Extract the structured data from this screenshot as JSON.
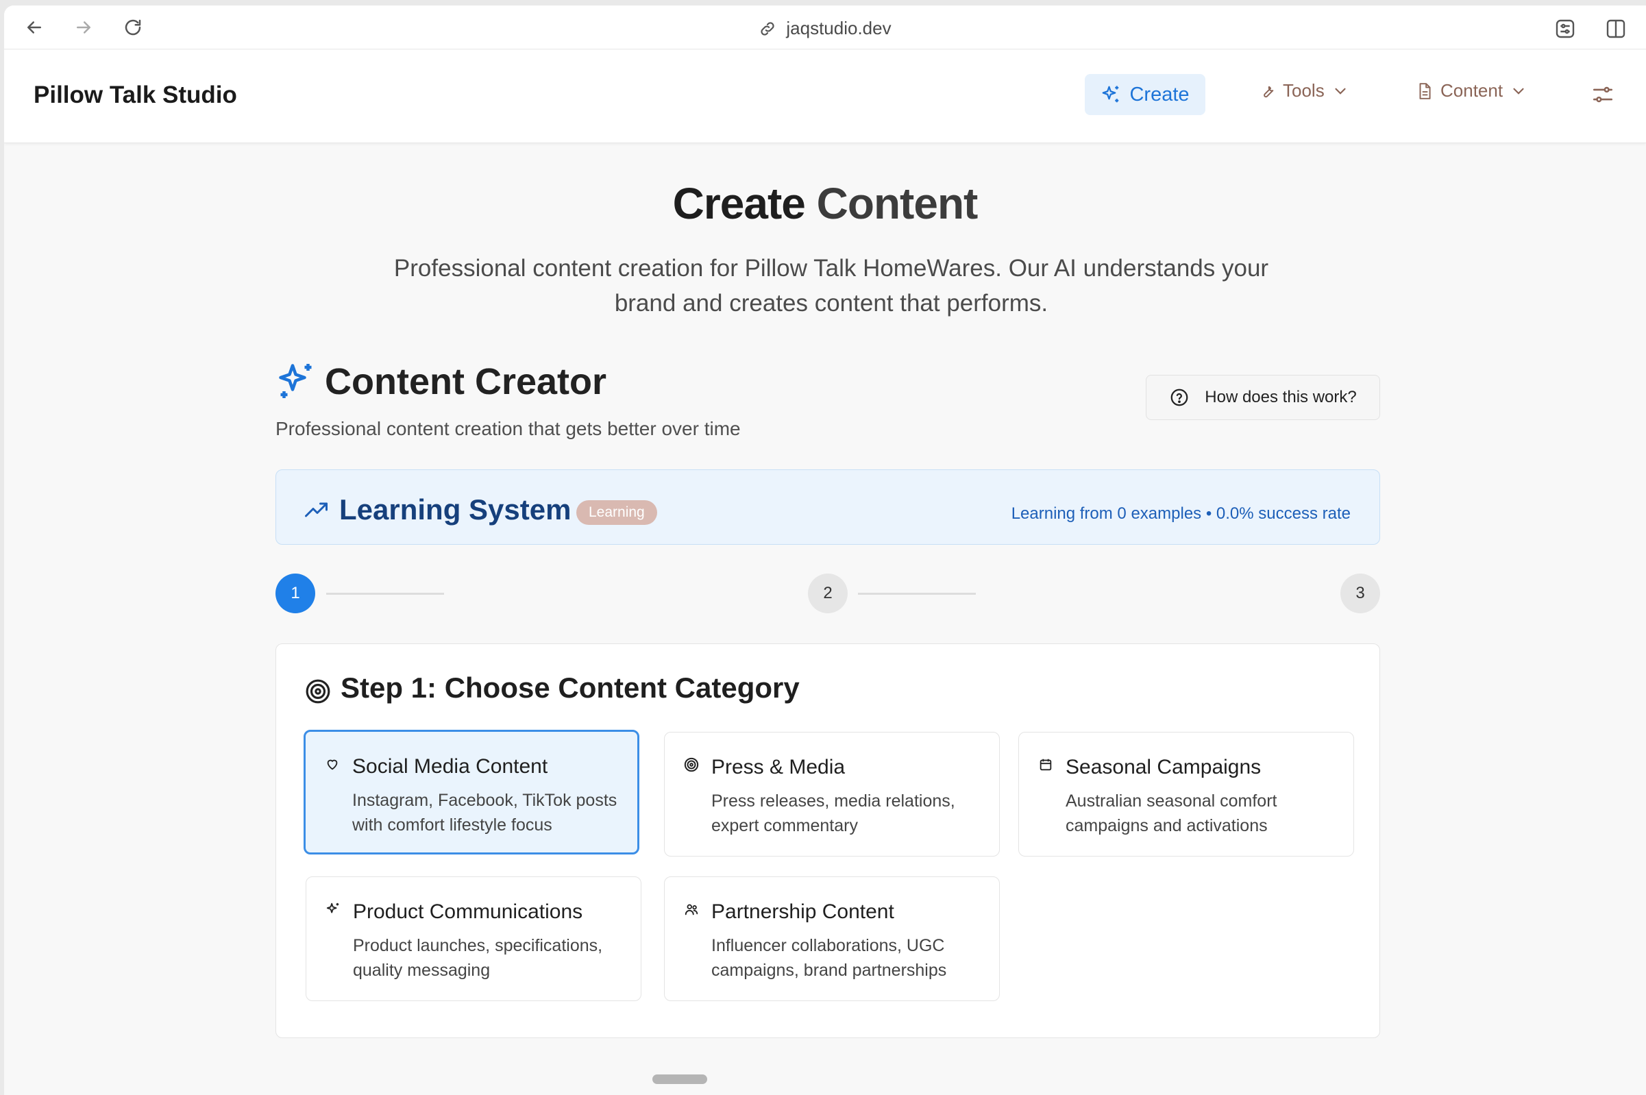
{
  "browser": {
    "url": "jaqstudio.dev",
    "back_icon": "arrow-left-icon",
    "forward_icon": "arrow-right-icon",
    "reload_icon": "reload-icon"
  },
  "header": {
    "brand": "Pillow Talk Studio",
    "nav": {
      "create": "Create",
      "tools": "Tools",
      "content": "Content"
    }
  },
  "hero": {
    "title_part1": "Create",
    "title_part2": "Content",
    "subtitle": "Professional content creation for Pillow Talk HomeWares. Our AI understands your brand and creates content that performs."
  },
  "creator": {
    "title": "Content Creator",
    "subtitle": "Professional content creation that gets better over time",
    "help_button": "How does this work?"
  },
  "learning": {
    "title": "Learning System",
    "badge": "Learning",
    "stats": "Learning from 0 examples • 0.0% success rate"
  },
  "stepper": {
    "steps": [
      "1",
      "2",
      "3"
    ],
    "current": 1
  },
  "category_step": {
    "title": "Step 1: Choose Content Category",
    "options": [
      {
        "title": "Social Media Content",
        "desc": "Instagram, Facebook, TikTok posts with comfort lifestyle focus",
        "icon": "heart-icon",
        "selected": true
      },
      {
        "title": "Press & Media",
        "desc": "Press releases, media relations, expert commentary",
        "icon": "target-icon",
        "selected": false
      },
      {
        "title": "Seasonal Campaigns",
        "desc": "Australian seasonal comfort campaigns and activations",
        "icon": "calendar-icon",
        "selected": false
      },
      {
        "title": "Product Communications",
        "desc": "Product launches, specifications, quality messaging",
        "icon": "sparkles-icon",
        "selected": false
      },
      {
        "title": "Partnership Content",
        "desc": "Influencer collaborations, UGC campaigns, brand partnerships",
        "icon": "users-icon",
        "selected": false
      }
    ]
  },
  "colors": {
    "accent": "#2080e8",
    "brand_nav": "#8a6456",
    "learning_title": "#16407c"
  }
}
